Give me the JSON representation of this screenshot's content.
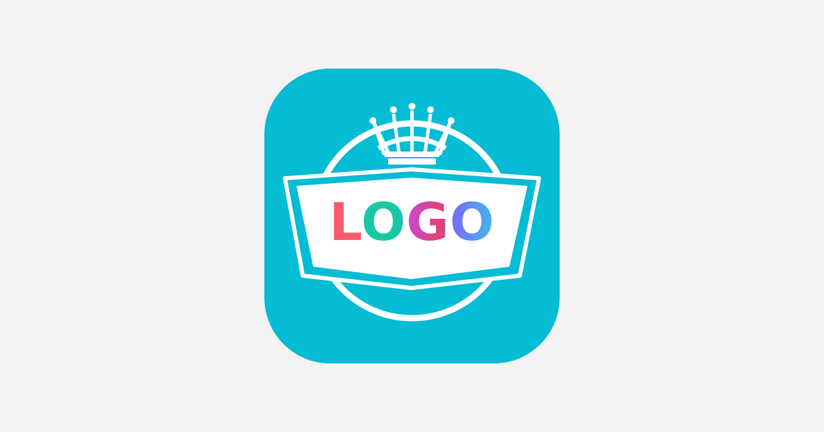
{
  "app_icon": {
    "name": "logo-quiz-app-icon",
    "background_color": "#04bcd4",
    "foreground_color": "#ffffff"
  },
  "badge": {
    "text": "LOGO",
    "letter_colors": [
      "#fb6a6a",
      "#18c8a2",
      "#d13f8e",
      "#4d8eea"
    ]
  },
  "crown": {
    "icon": "crown-icon"
  },
  "ring": {
    "icon": "circle-ring"
  }
}
